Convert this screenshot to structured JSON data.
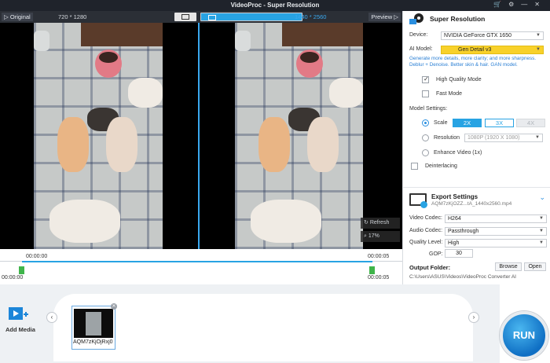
{
  "window": {
    "title": "VideoProc  -  Super Resolution"
  },
  "preview": {
    "original_label": "Original",
    "original_resolution": "720 * 1280",
    "output_resolution": "1440 * 2560",
    "preview_label": "Preview",
    "refresh_label": "Refresh",
    "zoom": "17%"
  },
  "settings": {
    "title": "Super Resolution",
    "device_label": "Device:",
    "device_value": "NVIDIA GeForce GTX 1650",
    "ai_model_label": "AI Model:",
    "ai_model_value": "Gen Detail v3",
    "ai_model_desc": "Generate more details, more clarity; and more sharpness. Deblur + Denoise. Better skin & hair. GAN model.",
    "high_quality_label": "High Quality Mode",
    "fast_mode_label": "Fast Mode",
    "model_settings_label": "Model Settings:",
    "scale_label": "Scale",
    "scale_options": [
      "2X",
      "3X",
      "4X"
    ],
    "resolution_label": "Resolution",
    "resolution_value": "1080P (1920 X 1080)",
    "enhance_label": "Enhance Video (1x)",
    "deinterlacing_label": "Deinterlacing"
  },
  "export": {
    "title": "Export Settings",
    "filename": "AQM7zKjOZZ...tA_1440x2560.mp4",
    "video_codec_label": "Video Codec:",
    "video_codec_value": "H264",
    "audio_codec_label": "Audio Codec:",
    "audio_codec_value": "Passthrough",
    "quality_label": "Quality Level:",
    "quality_value": "High",
    "gop_label": "GOP:",
    "gop_value": "30",
    "output_folder_label": "Output Folder:",
    "browse_label": "Browse",
    "open_label": "Open",
    "path": "C:\\Users\\ASUS\\Videos\\VideoProc Converter AI"
  },
  "timeline": {
    "start_top": "00:00:00",
    "end_top": "00:00:05",
    "start_bottom": "00:00:00",
    "end_bottom": "00:00:05"
  },
  "media": {
    "add_media_label": "Add Media",
    "thumb_name": "AQM7zKjOjRxj0"
  },
  "run_label": "RUN",
  "colors": {
    "accent": "#28a3e3",
    "model_highlight": "#f8d12a",
    "run": "#0f6fc4"
  }
}
